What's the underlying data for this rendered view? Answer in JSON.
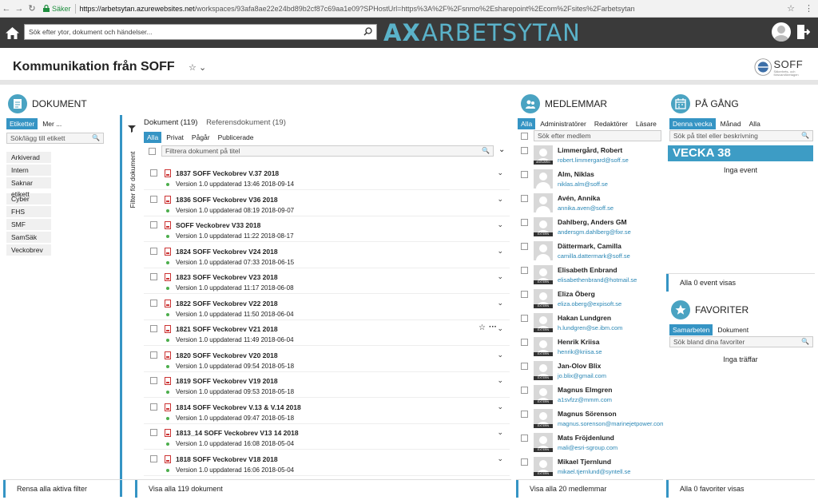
{
  "browser": {
    "secure_label": "Säker",
    "url_host": "https://arbetsytan.azurewebsites.net",
    "url_rest": "/workspaces/93afa8ae22e24bd89b2cf87c69aa1e09?SPHostUrl=https%3A%2F%2Fsnmo%2Esharepoint%2Ecom%2Fsites%2Farbetsytan"
  },
  "topbar": {
    "search_placeholder": "Sök efter ytor, dokument och händelser...",
    "logo_text": "ARBETSYTAN",
    "logo_mark": "AX"
  },
  "page": {
    "title": "Kommunikation från SOFF",
    "org_name": "SOFF",
    "org_sub": "Säkerhets- och försvarsföretagen"
  },
  "documents": {
    "title": "DOKUMENT",
    "tag_tabs": [
      "Etiketter",
      "Mer ..."
    ],
    "tag_search_placeholder": "Sök/lägg till etikett",
    "tags_group1": [
      "Arkiverad",
      "Intern",
      "Saknar etikett"
    ],
    "tags_group2": [
      "Cyber",
      "FHS",
      "SMF",
      "SamSäk",
      "Veckobrev"
    ],
    "filter_vertical": "Filter för dokument",
    "tabs": [
      "Dokument (119)",
      "Referensdokument (19)"
    ],
    "pills": [
      "Alla",
      "Privat",
      "Pågår",
      "Publicerade"
    ],
    "filter_placeholder": "Filtrera dokument på titel",
    "rows": [
      {
        "title": "1837 SOFF Veckobrev V.37 2018",
        "meta": "Version 1.0 uppdaterad 13:46 2018-09-14"
      },
      {
        "title": "1836 SOFF Veckobrev V36 2018",
        "meta": "Version 1.0 uppdaterad 08:19 2018-09-07"
      },
      {
        "title": "SOFF Veckobrev V33 2018",
        "meta": "Version 1.0 uppdaterad 11:22 2018-08-17"
      },
      {
        "title": "1824 SOFF Veckobrev V24 2018",
        "meta": "Version 1.0 uppdaterad 07:33 2018-06-15"
      },
      {
        "title": "1823 SOFF Veckobrev V23 2018",
        "meta": "Version 1.0 uppdaterad 11:17 2018-06-08"
      },
      {
        "title": "1822 SOFF Veckobrev V22 2018",
        "meta": "Version 1.0 uppdaterad 11:50 2018-06-04"
      },
      {
        "title": "1821 SOFF Veckobrev V21 2018",
        "meta": "Version 1.0 uppdaterad 11:49 2018-06-04"
      },
      {
        "title": "1820 SOFF Veckobrev V20 2018",
        "meta": "Version 1.0 uppdaterad 09:54 2018-05-18"
      },
      {
        "title": "1819 SOFF Veckobrev V19 2018",
        "meta": "Version 1.0 uppdaterad 09:53 2018-05-18"
      },
      {
        "title": "1814 SOFF Veckobrev V.13 & V.14 2018",
        "meta": "Version 1.0 uppdaterad 09:47 2018-05-18"
      },
      {
        "title": "1813_14 SOFF Veckobrev V13 14 2018",
        "meta": "Version 1.0 uppdaterad 16:08 2018-05-04"
      },
      {
        "title": "1818 SOFF Veckobrev V18 2018",
        "meta": "Version 1.0 uppdaterad 16:06 2018-05-04"
      }
    ],
    "footer_left": "Rensa alla aktiva filter",
    "footer_right": "Visa alla 119 dokument"
  },
  "members": {
    "title": "MEDLEMMAR",
    "pills": [
      "Alla",
      "Administratörer",
      "Redaktörer",
      "Läsare"
    ],
    "search_placeholder": "Sök efter medlem",
    "avatar_labels": [
      "ANSVARIG",
      "EXTERN"
    ],
    "list": [
      {
        "name": "Limmergård, Robert",
        "email": "robert.limmergard@soff.se",
        "label": "ANSVARIG"
      },
      {
        "name": "Alm, Niklas",
        "email": "niklas.alm@soff.se",
        "label": ""
      },
      {
        "name": "Avén, Annika",
        "email": "annika.aven@soff.se",
        "label": ""
      },
      {
        "name": "Dahlberg, Anders GM",
        "email": "andersgm.dahlberg@fixr.se",
        "label": "EXTERN"
      },
      {
        "name": "Dättermark, Camilla",
        "email": "camilla.dattermark@soff.se",
        "label": ""
      },
      {
        "name": "Elisabeth Enbrand",
        "email": "elisabethenbrand@hotmail.se",
        "label": "EXTERN"
      },
      {
        "name": "Eliza Öberg",
        "email": "eliza.oberg@expisoft.se",
        "label": "EXTERN"
      },
      {
        "name": "Hakan Lundgren",
        "email": "h.lundgren@se.ibm.com",
        "label": "EXTERN"
      },
      {
        "name": "Henrik Kriisa",
        "email": "henrik@kriisa.se",
        "label": "EXTERN"
      },
      {
        "name": "Jan-Olov Blix",
        "email": "jo.blix@gmail.com",
        "label": "EXTERN"
      },
      {
        "name": "Magnus Elmgren",
        "email": "a1svfzz@mmm.com",
        "label": "EXTERN"
      },
      {
        "name": "Magnus Sörenson",
        "email": "magnus.sorenson@marinejetpower.com",
        "label": "EXTERN"
      },
      {
        "name": "Mats Fröjdenlund",
        "email": "mali@esri-sgroup.com",
        "label": "EXTERN"
      },
      {
        "name": "Mikael Tjernlund",
        "email": "mikael.tjernlund@syntell.se",
        "label": "EXTERN"
      }
    ],
    "footer": "Visa alla 20 medlemmar"
  },
  "events": {
    "title": "PÅ GÅNG",
    "pills": [
      "Denna vecka",
      "Månad",
      "Alla"
    ],
    "search_placeholder": "Sök på titel eller beskrivning",
    "week_label": "VECKA 38",
    "empty": "Inga event",
    "footer": "Alla 0 event visas"
  },
  "favorites": {
    "title": "FAVORITER",
    "pills": [
      "Samarbeten",
      "Dokument"
    ],
    "search_placeholder": "Sök bland dina favoriter",
    "empty": "Inga träffar",
    "footer": "Alla 0 favoriter visas"
  },
  "colors": {
    "accent": "#3594c4",
    "topbar": "#3a3a3a",
    "logo": "#5ab2c9"
  }
}
